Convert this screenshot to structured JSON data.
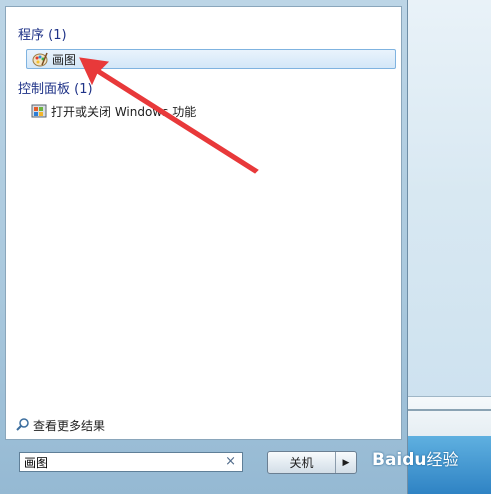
{
  "start_menu": {
    "sections": [
      {
        "title": "程序 (1)",
        "items": [
          {
            "label": "画图"
          }
        ]
      },
      {
        "title": "控制面板 (1)",
        "items": [
          {
            "label": "打开或关闭 Windows 功能"
          }
        ]
      }
    ],
    "see_more_label": "查看更多结果",
    "search": {
      "value": "画图",
      "clear_glyph": "×"
    },
    "shutdown": {
      "label": "关机",
      "arrow_glyph": "▶"
    }
  },
  "watermark": {
    "text": "Bai",
    "tail": "经验",
    "mid": "du"
  },
  "annotation": {
    "color": "#e8393a"
  },
  "icons": {
    "paint": "paint-palette-icon",
    "windows_features": "windows-features-icon",
    "search": "search-magnifier-icon"
  }
}
